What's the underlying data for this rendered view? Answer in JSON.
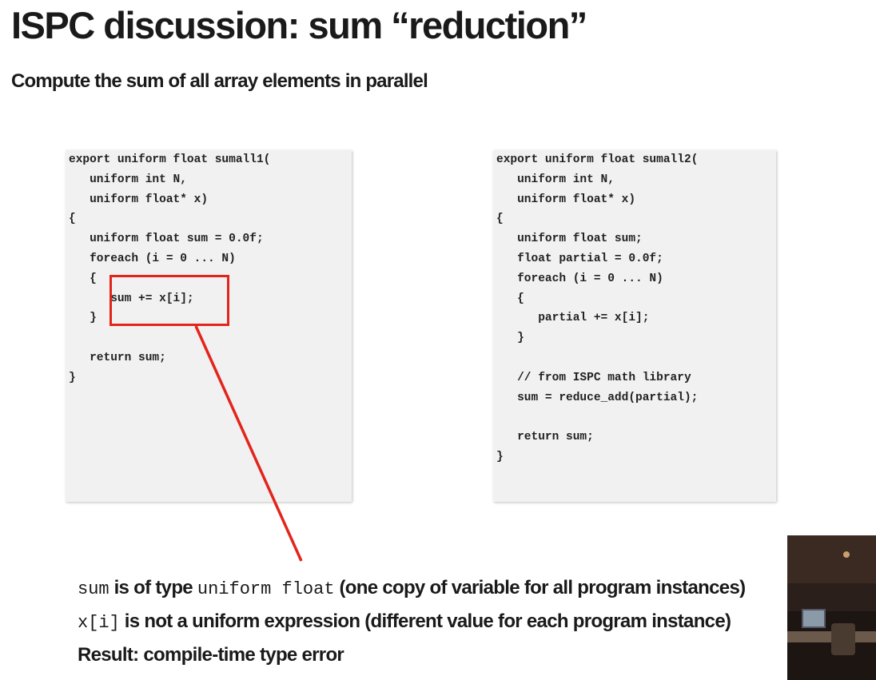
{
  "slide": {
    "title": "ISPC discussion: sum “reduction”",
    "subtitle": "Compute the sum of all array elements in parallel"
  },
  "code_left": [
    "export uniform float sumall1(",
    "   uniform int N,",
    "   uniform float* x)",
    "{",
    "   uniform float sum = 0.0f;",
    "   foreach (i = 0 ... N)",
    "   {",
    "      sum += x[i];",
    "   }",
    "",
    "   return sum;",
    "}"
  ],
  "code_right": [
    "export uniform float sumall2(",
    "   uniform int N,",
    "   uniform float* x)",
    "{",
    "   uniform float sum;",
    "   float partial = 0.0f;",
    "   foreach (i = 0 ... N)",
    "   {",
    "      partial += x[i];",
    "   }",
    "",
    "   // from ISPC math library",
    "   sum = reduce_add(partial);",
    "",
    "   return sum;",
    "}"
  ],
  "notes": {
    "line1_code1": "sum",
    "line1_text1": " is of type ",
    "line1_code2": "uniform float",
    "line1_text2": " (one copy of variable for all program instances)",
    "line2_code1": "x[i]",
    "line2_text1": " is not a uniform expression (different value for each program instance)",
    "line3_text": "Result: compile-time type error"
  },
  "colors": {
    "highlight": "#e3241b",
    "code_background": "#f1f1f1"
  }
}
